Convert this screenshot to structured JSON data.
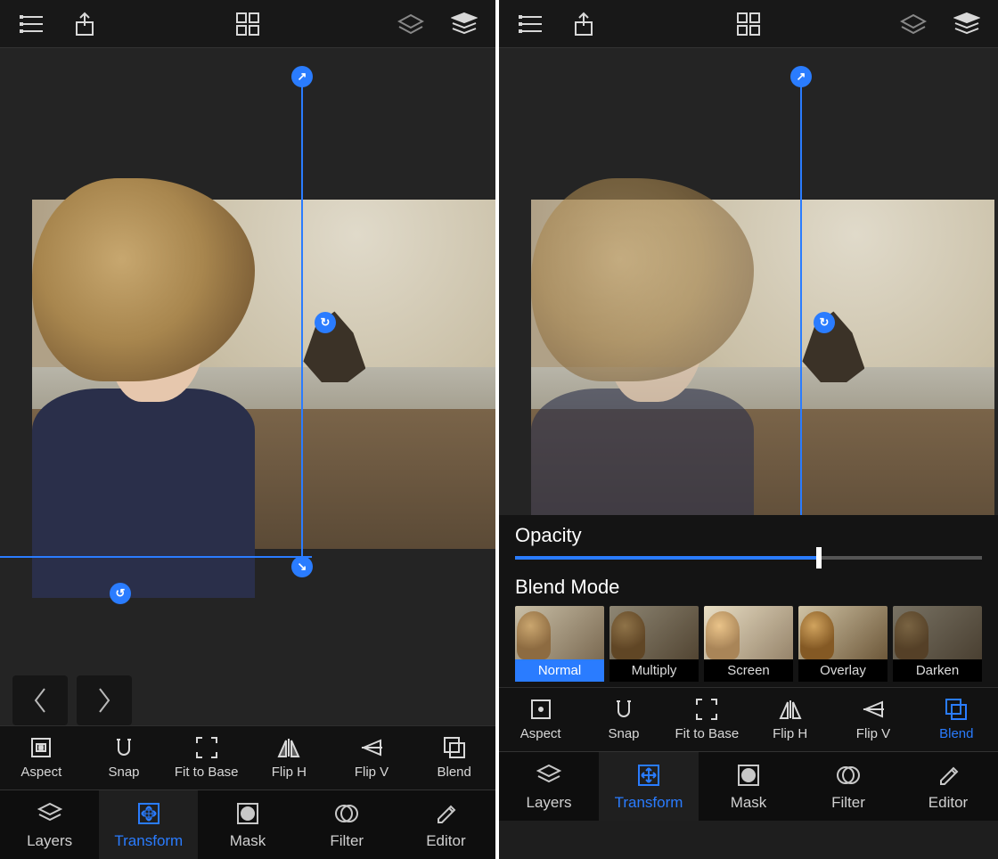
{
  "left": {
    "topbar": [
      "list",
      "share",
      "grid",
      "layer-single",
      "layer-stack"
    ],
    "midbar": [
      {
        "key": "aspect",
        "label": "Aspect"
      },
      {
        "key": "snap",
        "label": "Snap"
      },
      {
        "key": "fit",
        "label": "Fit to Base"
      },
      {
        "key": "fliph",
        "label": "Flip H"
      },
      {
        "key": "flipv",
        "label": "Flip V"
      },
      {
        "key": "blend",
        "label": "Blend"
      }
    ],
    "midbar_active": null,
    "tabs": [
      {
        "key": "layers",
        "label": "Layers"
      },
      {
        "key": "transform",
        "label": "Transform"
      },
      {
        "key": "mask",
        "label": "Mask"
      },
      {
        "key": "filter",
        "label": "Filter"
      },
      {
        "key": "editor",
        "label": "Editor"
      }
    ],
    "tab_active": "transform"
  },
  "right": {
    "topbar": [
      "list",
      "share",
      "grid",
      "layer-single",
      "layer-stack"
    ],
    "blend": {
      "opacity_label": "Opacity",
      "opacity_value": 65,
      "mode_label": "Blend Mode",
      "modes": [
        "Normal",
        "Multiply",
        "Screen",
        "Overlay",
        "Darken"
      ],
      "mode_active": "Normal"
    },
    "midbar": [
      {
        "key": "aspect",
        "label": "Aspect"
      },
      {
        "key": "snap",
        "label": "Snap"
      },
      {
        "key": "fit",
        "label": "Fit to Base"
      },
      {
        "key": "fliph",
        "label": "Flip H"
      },
      {
        "key": "flipv",
        "label": "Flip V"
      },
      {
        "key": "blend",
        "label": "Blend"
      }
    ],
    "midbar_active": "blend",
    "tabs": [
      {
        "key": "layers",
        "label": "Layers"
      },
      {
        "key": "transform",
        "label": "Transform"
      },
      {
        "key": "mask",
        "label": "Mask"
      },
      {
        "key": "filter",
        "label": "Filter"
      },
      {
        "key": "editor",
        "label": "Editor"
      }
    ],
    "tab_active": "transform"
  }
}
